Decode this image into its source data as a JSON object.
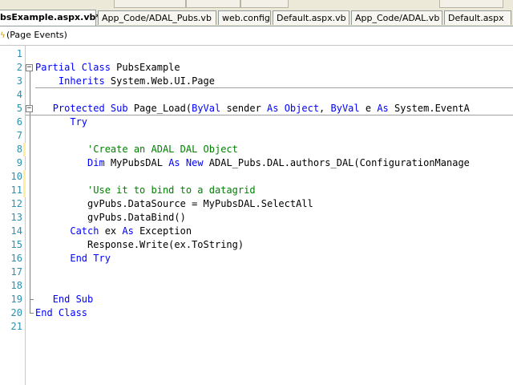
{
  "tabs": [
    {
      "label": "bsExample.aspx.vb*",
      "active": true
    },
    {
      "label": "App_Code/ADAL_Pubs.vb",
      "active": false
    },
    {
      "label": "web.config",
      "active": false
    },
    {
      "label": "Default.aspx.vb",
      "active": false
    },
    {
      "label": "App_Code/ADAL.vb",
      "active": false
    },
    {
      "label": "Default.aspx",
      "active": false
    }
  ],
  "member_dropdown": {
    "icon": "event-icon",
    "label": "(Page Events)"
  },
  "code_lines": [
    {
      "n": "1",
      "tokens": []
    },
    {
      "n": "2",
      "tokens": [
        {
          "t": "Partial Class",
          "c": "kw"
        },
        {
          "t": " PubsExample",
          "c": ""
        }
      ]
    },
    {
      "n": "3",
      "tokens": [
        {
          "t": "    ",
          "c": ""
        },
        {
          "t": "Inherits",
          "c": "kw"
        },
        {
          "t": " System.Web.UI.Page",
          "c": ""
        }
      ]
    },
    {
      "n": "4",
      "tokens": []
    },
    {
      "n": "5",
      "tokens": [
        {
          "t": "   ",
          "c": ""
        },
        {
          "t": "Protected Sub",
          "c": "kw"
        },
        {
          "t": " Page_Load(",
          "c": ""
        },
        {
          "t": "ByVal",
          "c": "kw"
        },
        {
          "t": " sender ",
          "c": ""
        },
        {
          "t": "As Object",
          "c": "kw"
        },
        {
          "t": ", ",
          "c": ""
        },
        {
          "t": "ByVal",
          "c": "kw"
        },
        {
          "t": " e ",
          "c": ""
        },
        {
          "t": "As",
          "c": "kw"
        },
        {
          "t": " System.EventA",
          "c": ""
        }
      ]
    },
    {
      "n": "6",
      "tokens": [
        {
          "t": "      ",
          "c": ""
        },
        {
          "t": "Try",
          "c": "kw"
        }
      ]
    },
    {
      "n": "7",
      "tokens": []
    },
    {
      "n": "8",
      "tokens": [
        {
          "t": "         ",
          "c": ""
        },
        {
          "t": "'Create an ADAL DAL Object",
          "c": "cm"
        }
      ]
    },
    {
      "n": "9",
      "tokens": [
        {
          "t": "         ",
          "c": ""
        },
        {
          "t": "Dim",
          "c": "kw"
        },
        {
          "t": " MyPubsDAL ",
          "c": ""
        },
        {
          "t": "As New",
          "c": "kw"
        },
        {
          "t": " ADAL_Pubs.DAL.authors_DAL(ConfigurationManage",
          "c": ""
        }
      ]
    },
    {
      "n": "10",
      "tokens": []
    },
    {
      "n": "11",
      "tokens": [
        {
          "t": "         ",
          "c": ""
        },
        {
          "t": "'Use it to bind to a datagrid",
          "c": "cm"
        }
      ]
    },
    {
      "n": "12",
      "tokens": [
        {
          "t": "         gvPubs.DataSource = MyPubsDAL.SelectAll",
          "c": ""
        }
      ]
    },
    {
      "n": "13",
      "tokens": [
        {
          "t": "         gvPubs.DataBind()",
          "c": ""
        }
      ]
    },
    {
      "n": "14",
      "tokens": [
        {
          "t": "      ",
          "c": ""
        },
        {
          "t": "Catch",
          "c": "kw"
        },
        {
          "t": " ex ",
          "c": ""
        },
        {
          "t": "As",
          "c": "kw"
        },
        {
          "t": " Exception",
          "c": ""
        }
      ]
    },
    {
      "n": "15",
      "tokens": [
        {
          "t": "         Response.Write(ex.ToString)",
          "c": ""
        }
      ]
    },
    {
      "n": "16",
      "tokens": [
        {
          "t": "      ",
          "c": ""
        },
        {
          "t": "End Try",
          "c": "kw"
        }
      ]
    },
    {
      "n": "17",
      "tokens": []
    },
    {
      "n": "18",
      "tokens": []
    },
    {
      "n": "19",
      "tokens": [
        {
          "t": "   ",
          "c": ""
        },
        {
          "t": "End Sub",
          "c": "kw"
        }
      ]
    },
    {
      "n": "20",
      "tokens": [
        {
          "t": "End Class",
          "c": "kw"
        }
      ]
    },
    {
      "n": "21",
      "tokens": []
    }
  ],
  "colors": {
    "keyword": "#0000ff",
    "comment": "#008000",
    "line_number": "#2b91af",
    "change_unsaved": "#ffef9a",
    "change_saved": "#c6e8a8"
  }
}
